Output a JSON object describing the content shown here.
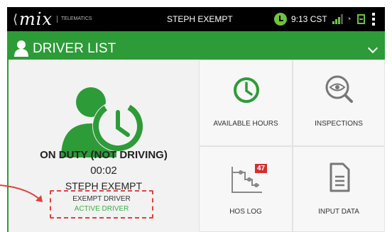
{
  "statusbar": {
    "brand": "mix",
    "brand_sub": "TELEMATICS",
    "driver": "STEPH EXEMPT",
    "time": "9:13 CST"
  },
  "header": {
    "title": "DRIVER LIST"
  },
  "driver_panel": {
    "status": "ON DUTY (NOT DRIVING)",
    "duration": "00:02",
    "name": "STEPH EXEMPT",
    "exempt_label": "EXEMPT DRIVER",
    "active_label": "ACTIVE DRIVER"
  },
  "tiles": {
    "available_hours": "AVAILABLE HOURS",
    "inspections": "INSPECTIONS",
    "hos_log": "HOS LOG",
    "hos_badge": "47",
    "input_data": "INPUT DATA"
  },
  "colors": {
    "brand_green": "#2d9b38",
    "accent_red": "#e0413c",
    "active_green": "#3ab049"
  }
}
